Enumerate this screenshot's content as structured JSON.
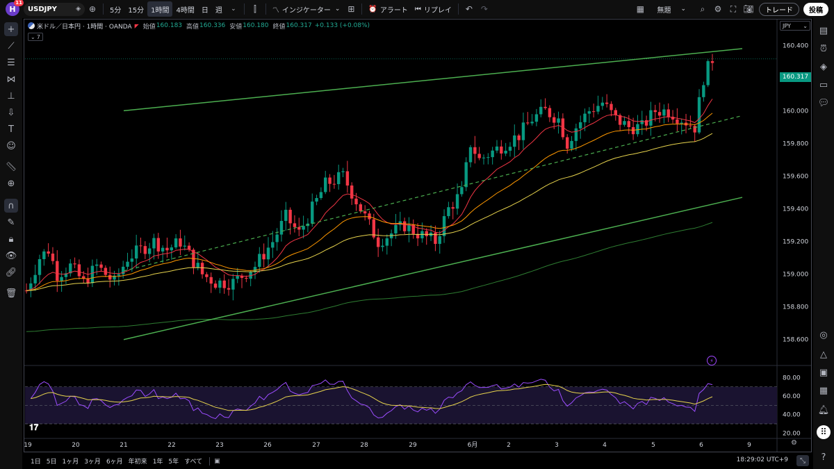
{
  "topbar": {
    "logo_letter": "H",
    "notification_count": "11",
    "symbol": "USDJPY",
    "intervals": [
      "5分",
      "15分",
      "1時間",
      "4時間",
      "日",
      "週"
    ],
    "active_interval": "1時間",
    "indicators_label": "インジケーター",
    "alert_label": "アラート",
    "replay_label": "リプレイ",
    "layout_name": "無題",
    "trade_label": "トレード",
    "post_label": "投稿"
  },
  "legend": {
    "title": "米ドル／日本円 · 1時間 · OANDA",
    "open_label": "始値",
    "open": "160.183",
    "high_label": "高値",
    "high": "160.336",
    "low_label": "安値",
    "low": "160.180",
    "close_label": "終値",
    "close": "160.317",
    "change": "+0.133 (+0.08%)",
    "indicator_count": "7"
  },
  "currency": "JPY",
  "current_price": "160.317",
  "bottombar": {
    "ranges": [
      "1日",
      "5日",
      "1ヶ月",
      "3ヶ月",
      "6ヶ月",
      "年初来",
      "1年",
      "5年",
      "すべて"
    ],
    "time": "18:29:02 UTC+9"
  },
  "colors": {
    "up": "#089981",
    "down": "#f23645",
    "channel": "#4caf50",
    "rsi": "#9c4dff",
    "rsi_ma": "#e8d44d"
  },
  "chart_data": {
    "type": "candlestick",
    "symbol": "USDJPY",
    "interval": "1時間",
    "y_ticks": [
      160.4,
      160.2,
      160.0,
      159.8,
      159.6,
      159.4,
      159.2,
      159.0,
      158.8,
      158.6
    ],
    "y_tick_labels": [
      "160.400",
      "160.200",
      "160.000",
      "159.800",
      "159.600",
      "159.400",
      "159.200",
      "159.000",
      "158.800",
      "158.600"
    ],
    "ylim": [
      158.45,
      160.55
    ],
    "x_ticks": [
      "19",
      "20",
      "21",
      "22",
      "23",
      "26",
      "27",
      "28",
      "29",
      "6月",
      "2",
      "3",
      "4",
      "5",
      "6",
      "9"
    ],
    "close_path": [
      [
        0,
        158.9
      ],
      [
        3,
        159.1
      ],
      [
        5,
        159.15
      ],
      [
        7,
        159.0
      ],
      [
        10,
        159.05
      ],
      [
        13,
        158.95
      ],
      [
        16,
        159.05
      ],
      [
        20,
        158.95
      ],
      [
        23,
        159.1
      ],
      [
        26,
        159.15
      ],
      [
        29,
        159.2
      ],
      [
        32,
        159.15
      ],
      [
        35,
        159.2
      ],
      [
        40,
        159.0
      ],
      [
        43,
        158.95
      ],
      [
        47,
        158.95
      ],
      [
        52,
        159.05
      ],
      [
        56,
        159.2
      ],
      [
        59,
        159.35
      ],
      [
        62,
        159.25
      ],
      [
        65,
        159.4
      ],
      [
        68,
        159.55
      ],
      [
        72,
        159.6
      ],
      [
        74,
        159.5
      ],
      [
        77,
        159.35
      ],
      [
        80,
        159.2
      ],
      [
        83,
        159.25
      ],
      [
        86,
        159.3
      ],
      [
        89,
        159.25
      ],
      [
        93,
        159.2
      ],
      [
        96,
        159.4
      ],
      [
        99,
        159.5
      ],
      [
        101,
        159.8
      ],
      [
        103,
        159.7
      ],
      [
        106,
        159.75
      ],
      [
        109,
        159.8
      ],
      [
        112,
        159.85
      ],
      [
        115,
        159.95
      ],
      [
        118,
        160.0
      ],
      [
        121,
        159.95
      ],
      [
        123,
        159.8
      ],
      [
        125,
        159.9
      ],
      [
        128,
        160.0
      ],
      [
        131,
        160.05
      ],
      [
        134,
        159.95
      ],
      [
        137,
        159.9
      ],
      [
        140,
        159.9
      ],
      [
        143,
        160.0
      ],
      [
        146,
        160.0
      ],
      [
        149,
        159.95
      ],
      [
        152,
        159.9
      ],
      [
        154,
        160.2
      ],
      [
        156,
        160.317
      ]
    ],
    "channel_upper": [
      [
        178,
        160.0
      ],
      [
        1068,
        160.38
      ]
    ],
    "channel_lower": [
      [
        178,
        158.6
      ],
      [
        1068,
        159.47
      ]
    ],
    "channel_mid": [
      [
        178,
        159.02
      ],
      [
        1068,
        159.97
      ]
    ],
    "rsi": {
      "ticks": [
        80,
        60,
        40,
        20
      ],
      "tick_labels": [
        "80.00",
        "60.00",
        "40.00",
        "20.00"
      ],
      "bands": [
        70,
        30
      ],
      "mid": 50,
      "ylim": [
        15,
        90
      ]
    }
  }
}
